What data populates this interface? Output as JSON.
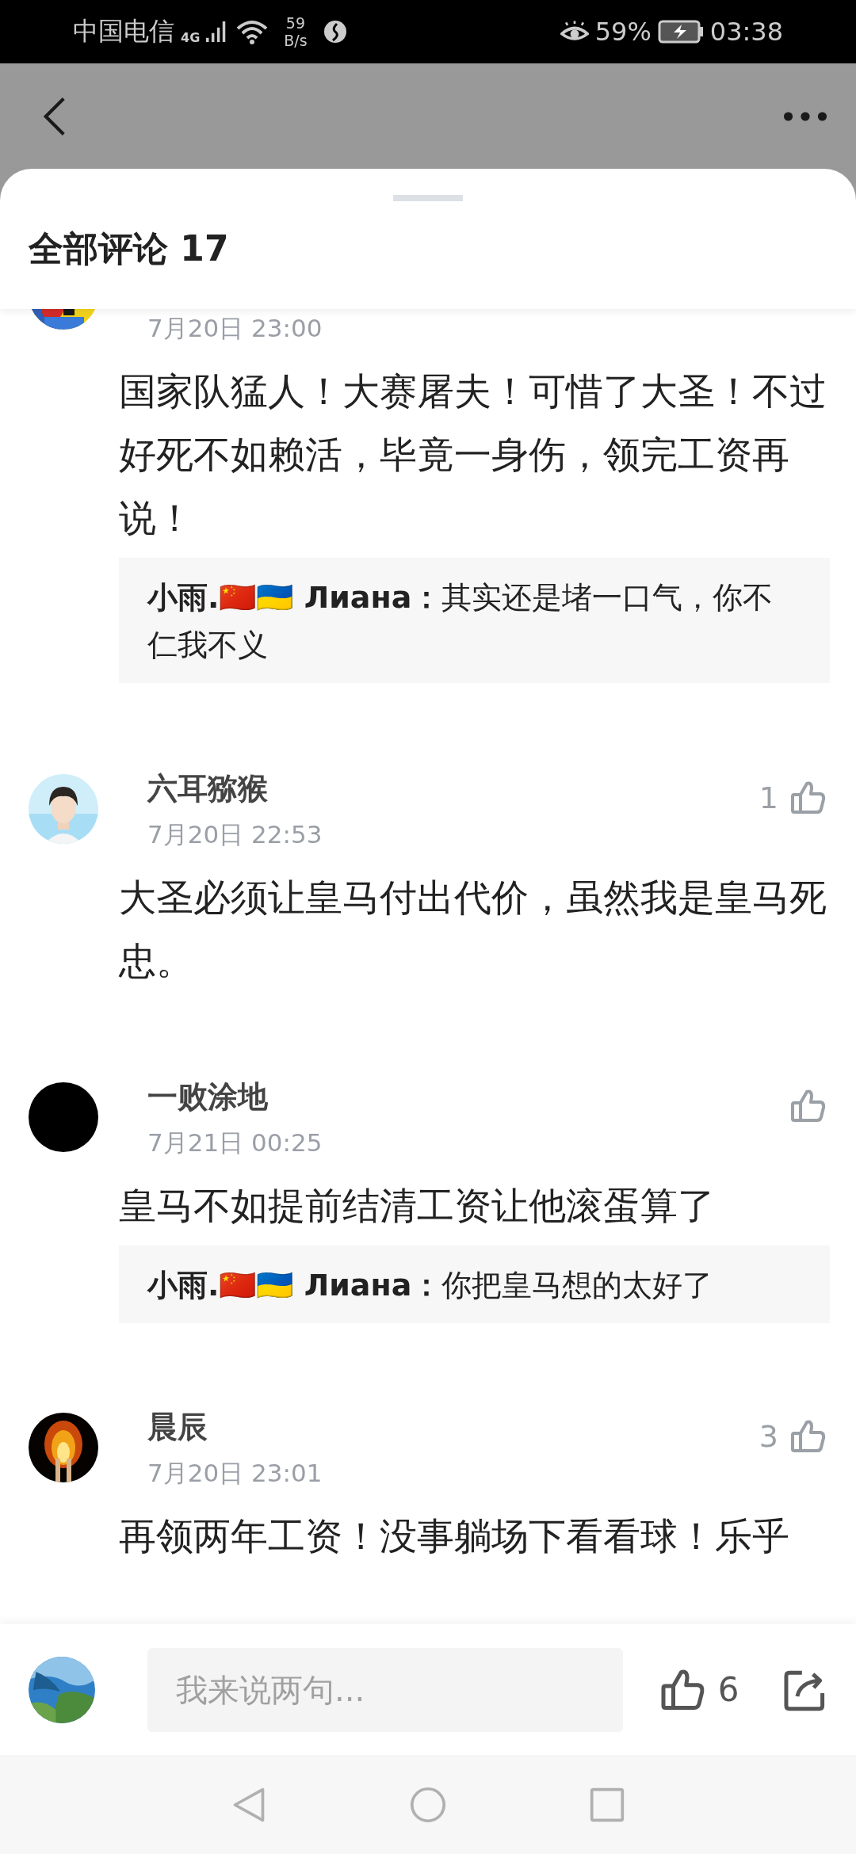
{
  "status_bar": {
    "carrier": "中国电信",
    "network": "4G",
    "speed_value": "59",
    "speed_unit": "B/s",
    "battery_percent": "59%",
    "time": "03:38"
  },
  "sheet": {
    "title": "全部评论 17"
  },
  "comments": [
    {
      "date": "7月20日 23:00",
      "text": "国家队猛人！大赛屠夫！可惜了大圣！不过好死不如赖活，毕竟一身伤，领完工资再说！",
      "replies": [
        {
          "text": "**小雨.🇨🇳🇺🇦 Лиана：**其实还是堵一口气，你不仁我不义"
        }
      ]
    },
    {
      "name": "六耳猕猴",
      "date": "7月20日 22:53",
      "likes": "1",
      "text": "大圣必须让皇马付出代价，虽然我是皇马死忠。"
    },
    {
      "name": "一败涂地",
      "date": "7月21日 00:25",
      "text": "皇马不如提前结清工资让他滚蛋算了",
      "replies": [
        {
          "text": "**小雨.🇨🇳🇺🇦 Лиана：**你把皇马想的太好了"
        }
      ]
    },
    {
      "name": "晨辰",
      "date": "7月20日 23:01",
      "likes": "3",
      "text": "再领两年工资！没事躺场下看看球！乐乎"
    }
  ],
  "composer": {
    "placeholder": "我来说两句...",
    "likes": "6"
  }
}
